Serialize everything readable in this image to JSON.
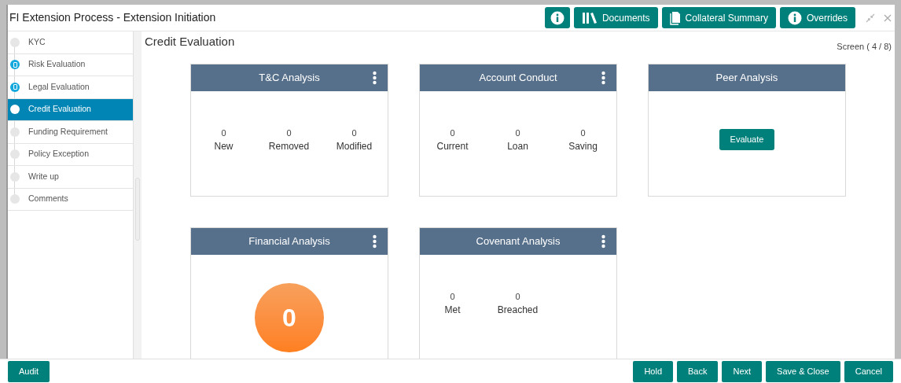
{
  "window": {
    "title": "FI Extension Process - Extension Initiation"
  },
  "header_buttons": [
    {
      "kind": "info"
    },
    {
      "kind": "documents",
      "label": "Documents"
    },
    {
      "kind": "collateral",
      "label": "Collateral Summary"
    },
    {
      "kind": "info",
      "label": "Overrides"
    }
  ],
  "sidebar": {
    "items": [
      {
        "label": "KYC",
        "selected": false,
        "completed": false
      },
      {
        "label": "Risk Evaluation",
        "selected": false,
        "completed": true
      },
      {
        "label": "Legal Evaluation",
        "selected": false,
        "completed": true
      },
      {
        "label": "Credit Evaluation",
        "selected": true,
        "completed": false
      },
      {
        "label": "Funding Requirement",
        "selected": false,
        "completed": false
      },
      {
        "label": "Policy Exception",
        "selected": false,
        "completed": false
      },
      {
        "label": "Write up",
        "selected": false,
        "completed": false
      },
      {
        "label": "Comments",
        "selected": false,
        "completed": false
      }
    ]
  },
  "page": {
    "title": "Credit Evaluation",
    "screen_counter": "Screen ( 4 / 8)"
  },
  "cards": [
    {
      "title": "T&C Analysis",
      "kind": "stats",
      "menu": true,
      "stats": [
        {
          "value": "0",
          "label": "New"
        },
        {
          "value": "0",
          "label": "Removed"
        },
        {
          "value": "0",
          "label": "Modified"
        }
      ]
    },
    {
      "title": "Account Conduct",
      "kind": "stats",
      "menu": true,
      "stats": [
        {
          "value": "0",
          "label": "Current"
        },
        {
          "value": "0",
          "label": "Loan"
        },
        {
          "value": "0",
          "label": "Saving"
        }
      ]
    },
    {
      "title": "Peer Analysis",
      "kind": "button",
      "menu": false,
      "button": "Evaluate"
    },
    {
      "title": "Financial Analysis",
      "kind": "gauge",
      "menu": true,
      "value": "0"
    },
    {
      "title": "Covenant Analysis",
      "kind": "stats",
      "menu": true,
      "stats": [
        {
          "value": "0",
          "label": "Met"
        },
        {
          "value": "0",
          "label": "Breached"
        }
      ]
    }
  ],
  "footer": {
    "left": [
      "Audit"
    ],
    "right": [
      "Hold",
      "Back",
      "Next",
      "Save & Close",
      "Cancel"
    ]
  }
}
